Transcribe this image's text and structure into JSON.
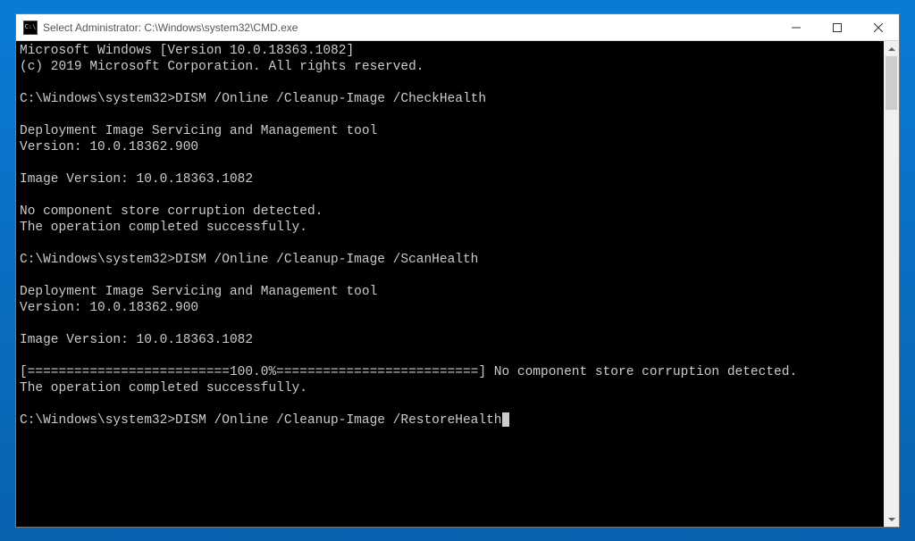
{
  "window": {
    "title": "Select Administrator: C:\\Windows\\system32\\CMD.exe",
    "icon_label": "C:\\"
  },
  "terminal": {
    "lines": [
      "Microsoft Windows [Version 10.0.18363.1082]",
      "(c) 2019 Microsoft Corporation. All rights reserved.",
      "",
      "C:\\Windows\\system32>DISM /Online /Cleanup-Image /CheckHealth",
      "",
      "Deployment Image Servicing and Management tool",
      "Version: 10.0.18362.900",
      "",
      "Image Version: 10.0.18363.1082",
      "",
      "No component store corruption detected.",
      "The operation completed successfully.",
      "",
      "C:\\Windows\\system32>DISM /Online /Cleanup-Image /ScanHealth",
      "",
      "Deployment Image Servicing and Management tool",
      "Version: 10.0.18362.900",
      "",
      "Image Version: 10.0.18363.1082",
      "",
      "[==========================100.0%==========================] No component store corruption detected.",
      "The operation completed successfully.",
      ""
    ],
    "current_prompt": "C:\\Windows\\system32>DISM /Online /Cleanup-Image /RestoreHealth"
  }
}
